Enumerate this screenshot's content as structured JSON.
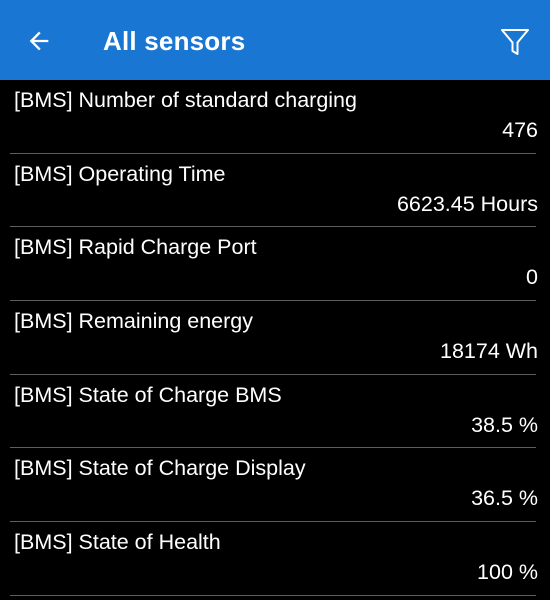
{
  "app_bar": {
    "title": "All sensors",
    "back_icon": "arrow-left-icon",
    "filter_icon": "filter-icon",
    "color": "#1976D2"
  },
  "sensors": [
    {
      "label": "[BMS] Number of standard charging",
      "value": "476"
    },
    {
      "label": "[BMS] Operating Time",
      "value": "6623.45 Hours"
    },
    {
      "label": "[BMS] Rapid Charge Port",
      "value": "0"
    },
    {
      "label": "[BMS] Remaining energy",
      "value": "18174 Wh"
    },
    {
      "label": "[BMS] State of Charge BMS",
      "value": "38.5 %"
    },
    {
      "label": "[BMS] State of Charge Display",
      "value": "36.5 %"
    },
    {
      "label": "[BMS] State of Health",
      "value": "100 %"
    }
  ]
}
